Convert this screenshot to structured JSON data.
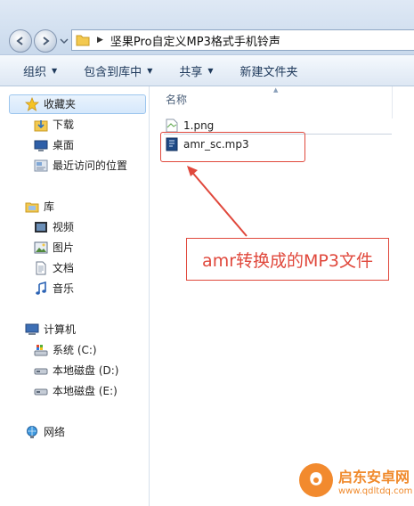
{
  "address_bar": {
    "path": "坚果Pro自定义MP3格式手机铃声"
  },
  "toolbar": {
    "items": [
      {
        "label": "组织",
        "dropdown": true
      },
      {
        "label": "包含到库中",
        "dropdown": true
      },
      {
        "label": "共享",
        "dropdown": true
      },
      {
        "label": "新建文件夹",
        "dropdown": false
      }
    ]
  },
  "sidebar": {
    "favorites": {
      "label": "收藏夹",
      "items": [
        {
          "label": "下载",
          "icon": "download-folder-icon"
        },
        {
          "label": "桌面",
          "icon": "desktop-icon"
        },
        {
          "label": "最近访问的位置",
          "icon": "recent-places-icon"
        }
      ]
    },
    "libraries": {
      "label": "库",
      "items": [
        {
          "label": "视频",
          "icon": "video-icon"
        },
        {
          "label": "图片",
          "icon": "pictures-icon"
        },
        {
          "label": "文档",
          "icon": "documents-icon"
        },
        {
          "label": "音乐",
          "icon": "music-icon"
        }
      ]
    },
    "computer": {
      "label": "计算机",
      "items": [
        {
          "label": "系统 (C:)",
          "icon": "system-drive-icon"
        },
        {
          "label": "本地磁盘 (D:)",
          "icon": "disk-drive-icon"
        },
        {
          "label": "本地磁盘 (E:)",
          "icon": "disk-drive-icon"
        }
      ]
    },
    "network": {
      "label": "网络"
    }
  },
  "content": {
    "column_header": "名称",
    "files": [
      {
        "name": "1.png",
        "icon": "image-file-icon"
      },
      {
        "name": "amr_sc.mp3",
        "icon": "audio-file-icon"
      }
    ]
  },
  "annotation": {
    "text": "amr转换成的MP3文件",
    "color": "#e0483c"
  },
  "watermark": {
    "title": "启东安卓网",
    "url": "www.qdltdq.com"
  }
}
